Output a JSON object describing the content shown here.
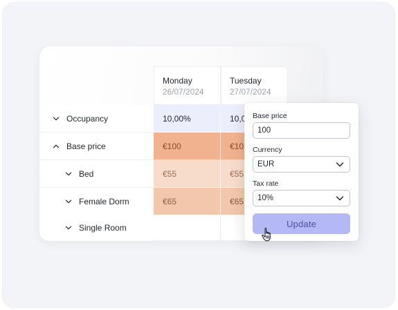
{
  "days": [
    {
      "name": "Monday",
      "date": "26/07/2024"
    },
    {
      "name": "Tuesday",
      "date": "27/07/2024"
    }
  ],
  "rows": [
    {
      "label": "Occupancy",
      "values": [
        "10,00%",
        "10,0"
      ]
    },
    {
      "label": "Base price",
      "values": [
        "€100",
        "€10"
      ]
    },
    {
      "label": "Bed",
      "values": [
        "€55",
        "€55"
      ]
    },
    {
      "label": "Female Dorm",
      "values": [
        "€65",
        "€65"
      ]
    },
    {
      "label": "Single Room",
      "values": [
        "",
        ""
      ]
    }
  ],
  "popup": {
    "base_price_label": "Base price",
    "base_price_value": "100",
    "currency_label": "Currency",
    "currency_value": "EUR",
    "tax_rate_label": "Tax rate",
    "tax_rate_value": "10%",
    "update_label": "Update"
  },
  "icons": {
    "row_expand": "chevron-down-icon",
    "row_collapse": "chevron-up-icon",
    "select_caret": "chevron-down-icon",
    "cursor": "hand-pointer-icon"
  },
  "colors": {
    "occupancy_bg": "#eceefc",
    "base_price_bg": "#f1b28f",
    "bed_bg": "#f8dccb",
    "female_dorm_bg": "#f3c7ab",
    "update_button_bg": "#b4b8f4",
    "update_button_text": "#4c4fa4"
  }
}
